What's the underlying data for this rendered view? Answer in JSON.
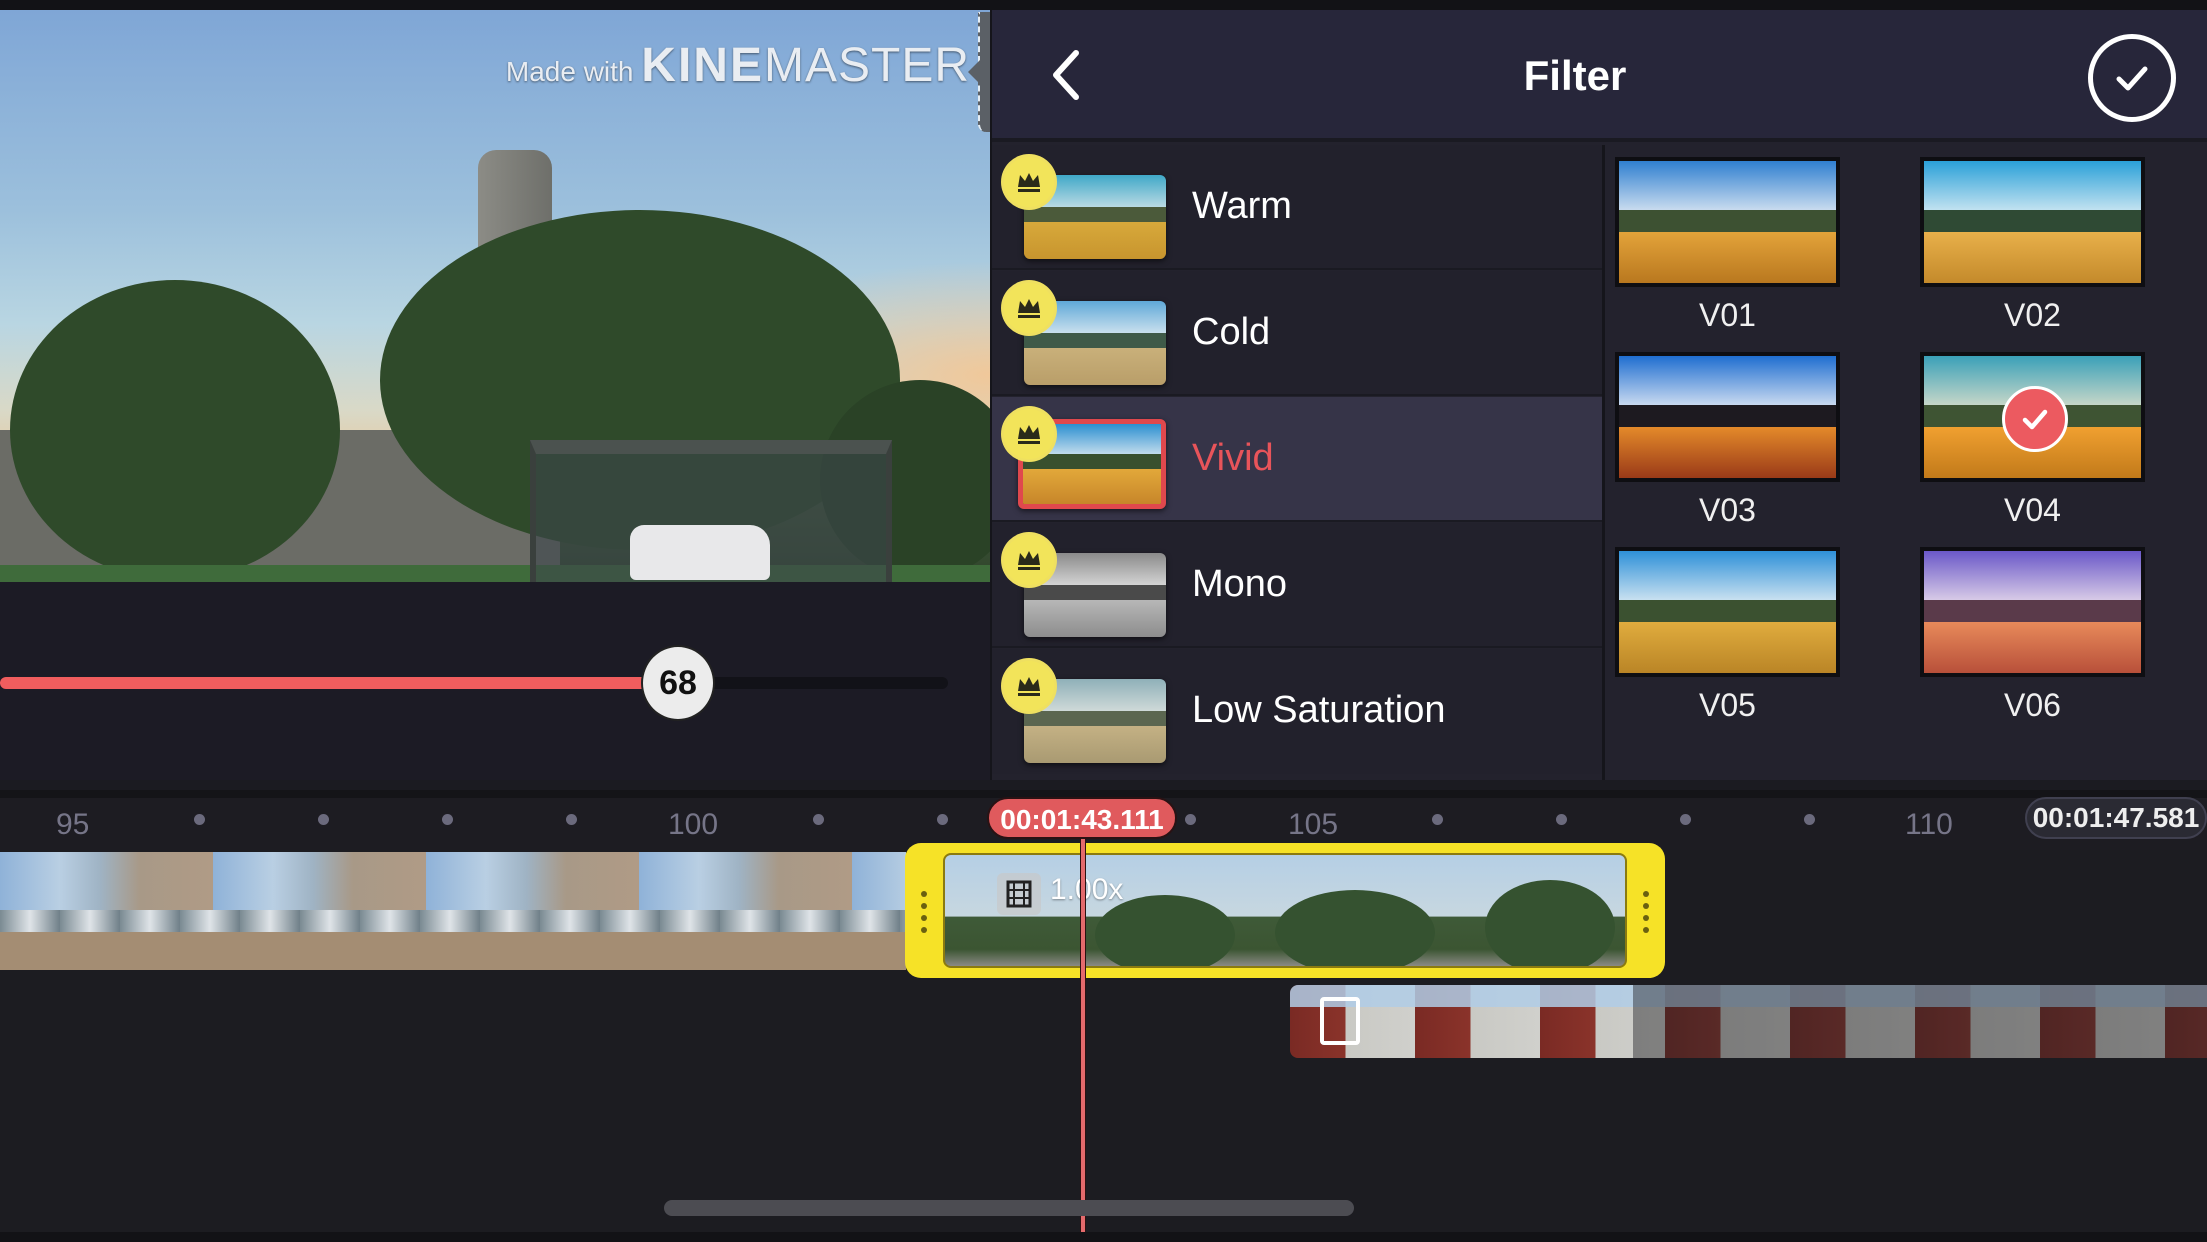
{
  "preview": {
    "watermark_prefix": "Made with",
    "watermark_brand_bold": "KINE",
    "watermark_brand_light": "MASTER"
  },
  "slider": {
    "value": 68,
    "value_label": "68",
    "fill_fraction": 0.68,
    "color": "#f05d5e"
  },
  "panel": {
    "title": "Filter",
    "back_icon": "chevron-left-icon",
    "confirm_icon": "check-circle-icon",
    "categories": [
      {
        "label": "Warm",
        "premium": true,
        "selected": false,
        "tone": "warm"
      },
      {
        "label": "Cold",
        "premium": true,
        "selected": false,
        "tone": "cold"
      },
      {
        "label": "Vivid",
        "premium": true,
        "selected": true,
        "tone": "vivid"
      },
      {
        "label": "Mono",
        "premium": true,
        "selected": false,
        "tone": "mono"
      },
      {
        "label": "Low Saturation",
        "premium": true,
        "selected": false,
        "tone": "lowsat"
      }
    ],
    "presets": [
      {
        "label": "V01",
        "selected": false
      },
      {
        "label": "V02",
        "selected": false
      },
      {
        "label": "V03",
        "selected": false
      },
      {
        "label": "V04",
        "selected": true
      },
      {
        "label": "V05",
        "selected": false
      },
      {
        "label": "V06",
        "selected": false
      }
    ],
    "selected_color": "#e8545a"
  },
  "timeline": {
    "ruler_labels": [
      "95",
      "100",
      "105",
      "110"
    ],
    "playhead_time": "00:01:43.111",
    "end_time": "00:01:47.581",
    "selected_clip": {
      "speed_label": "1.00x",
      "type_icon": "film-icon"
    },
    "overlay_clip": {
      "type_icon": "film-icon"
    },
    "accent_color": "#f6e227"
  }
}
